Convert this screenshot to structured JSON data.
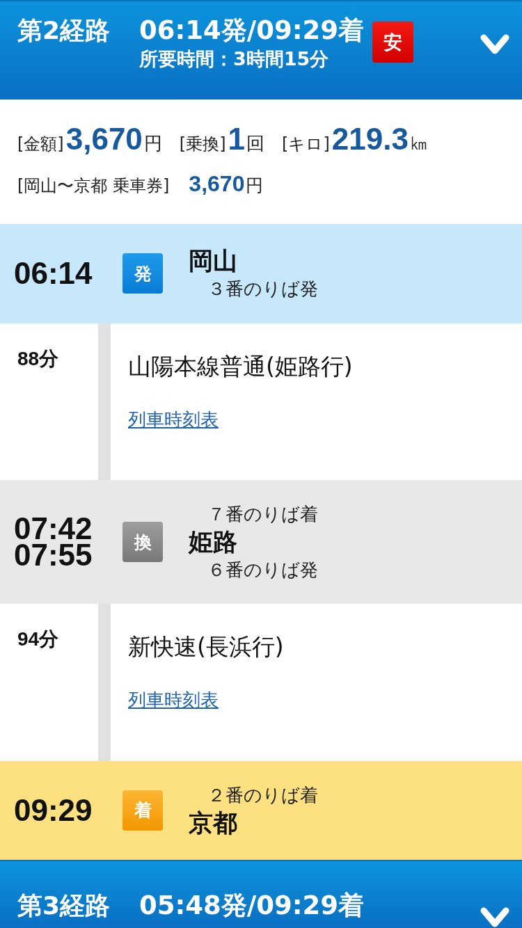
{
  "routes": [
    {
      "title": "第2経路",
      "times": "06:14発/09:29着",
      "duration": "所要時間：3時間15分",
      "badge": "安",
      "summary": {
        "items": [
          {
            "label": "[金額]",
            "value": "3,670",
            "unit": "円"
          },
          {
            "label": "[乗換]",
            "value": "1",
            "unit": "回"
          },
          {
            "label": "[キロ]",
            "value": "219.3",
            "unit": "㎞"
          }
        ],
        "ticket": {
          "label": "[岡山〜京都 乗車券]",
          "value": "3,670",
          "unit": "円"
        }
      },
      "steps": [
        {
          "kind": "departure",
          "times": [
            "06:14"
          ],
          "badge": "発",
          "lines": [
            {
              "kind": "name",
              "text": "岡山"
            },
            {
              "kind": "platform",
              "text": "３番のりば発"
            }
          ]
        },
        {
          "kind": "segment",
          "duration": "88分",
          "train": "山陽本線普通(姫路行)",
          "link": "列車時刻表"
        },
        {
          "kind": "transfer",
          "times": [
            "07:42",
            "07:55"
          ],
          "badge": "換",
          "lines": [
            {
              "kind": "platform",
              "text": "７番のりば着"
            },
            {
              "kind": "name",
              "text": "姫路"
            },
            {
              "kind": "platform",
              "text": "６番のりば発"
            }
          ]
        },
        {
          "kind": "segment",
          "duration": "94分",
          "train": "新快速(長浜行)",
          "link": "列車時刻表"
        },
        {
          "kind": "arrival",
          "times": [
            "09:29"
          ],
          "badge": "着",
          "lines": [
            {
              "kind": "platform",
              "text": "２番のりば着"
            },
            {
              "kind": "name",
              "text": "京都"
            }
          ]
        }
      ]
    },
    {
      "title": "第3経路",
      "times": "05:48発/09:29着"
    }
  ]
}
